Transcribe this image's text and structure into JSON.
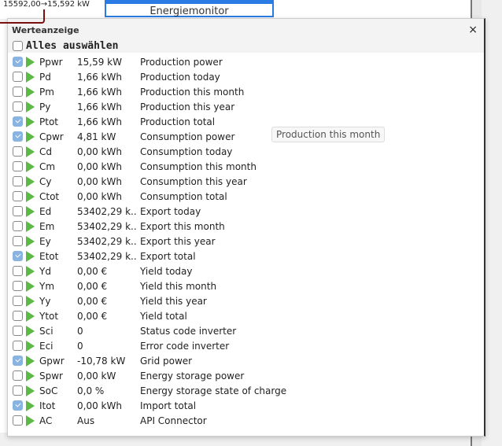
{
  "background": {
    "label": "15592,00→15,592 kW",
    "widget_title": "Energiemonitor"
  },
  "dialog": {
    "title": "Werteanzeige",
    "close_icon": "×",
    "select_all": {
      "label": "Alles auswählen",
      "checked": false
    },
    "rows": [
      {
        "code": "Ppwr",
        "value": "15,59 kW",
        "desc": "Production power",
        "checked": true
      },
      {
        "code": "Pd",
        "value": "1,66 kWh",
        "desc": "Production today",
        "checked": false
      },
      {
        "code": "Pm",
        "value": "1,66 kWh",
        "desc": "Production this month",
        "checked": false
      },
      {
        "code": "Py",
        "value": "1,66 kWh",
        "desc": "Production this year",
        "checked": false
      },
      {
        "code": "Ptot",
        "value": "1,66 kWh",
        "desc": "Production total",
        "checked": true
      },
      {
        "code": "Cpwr",
        "value": "4,81 kW",
        "desc": "Consumption power",
        "checked": true
      },
      {
        "code": "Cd",
        "value": "0,00 kWh",
        "desc": "Consumption today",
        "checked": false
      },
      {
        "code": "Cm",
        "value": "0,00 kWh",
        "desc": "Consumption this month",
        "checked": false
      },
      {
        "code": "Cy",
        "value": "0,00 kWh",
        "desc": "Consumption this year",
        "checked": false
      },
      {
        "code": "Ctot",
        "value": "0,00 kWh",
        "desc": "Consumption total",
        "checked": false
      },
      {
        "code": "Ed",
        "value": "53402,29 k...",
        "desc": "Export today",
        "checked": false
      },
      {
        "code": "Em",
        "value": "53402,29 k...",
        "desc": "Export this month",
        "checked": false
      },
      {
        "code": "Ey",
        "value": "53402,29 k...",
        "desc": "Export this year",
        "checked": false
      },
      {
        "code": "Etot",
        "value": "53402,29 k...",
        "desc": "Export total",
        "checked": true
      },
      {
        "code": "Yd",
        "value": "0,00 €",
        "desc": "Yield today",
        "checked": false
      },
      {
        "code": "Ym",
        "value": "0,00 €",
        "desc": "Yield this month",
        "checked": false
      },
      {
        "code": "Yy",
        "value": "0,00 €",
        "desc": "Yield this year",
        "checked": false
      },
      {
        "code": "Ytot",
        "value": "0,00 €",
        "desc": "Yield total",
        "checked": false
      },
      {
        "code": "Sci",
        "value": "0",
        "desc": "Status code inverter",
        "checked": false
      },
      {
        "code": "Eci",
        "value": "0",
        "desc": "Error code inverter",
        "checked": false
      },
      {
        "code": "Gpwr",
        "value": "-10,78 kW",
        "desc": "Grid power",
        "checked": true
      },
      {
        "code": "Spwr",
        "value": "0,00 kW",
        "desc": "Energy storage power",
        "checked": false
      },
      {
        "code": "SoC",
        "value": "0,0 %",
        "desc": "Energy storage state of charge",
        "checked": false
      },
      {
        "code": "Itot",
        "value": "0,00 kWh",
        "desc": "Import total",
        "checked": true
      },
      {
        "code": "AC",
        "value": "Aus",
        "desc": "API Connector",
        "checked": false
      }
    ],
    "tooltip": "Production this month"
  },
  "colors": {
    "accent": "#2a7be4",
    "play": "#5cb946",
    "checked": "#89b3e0"
  }
}
